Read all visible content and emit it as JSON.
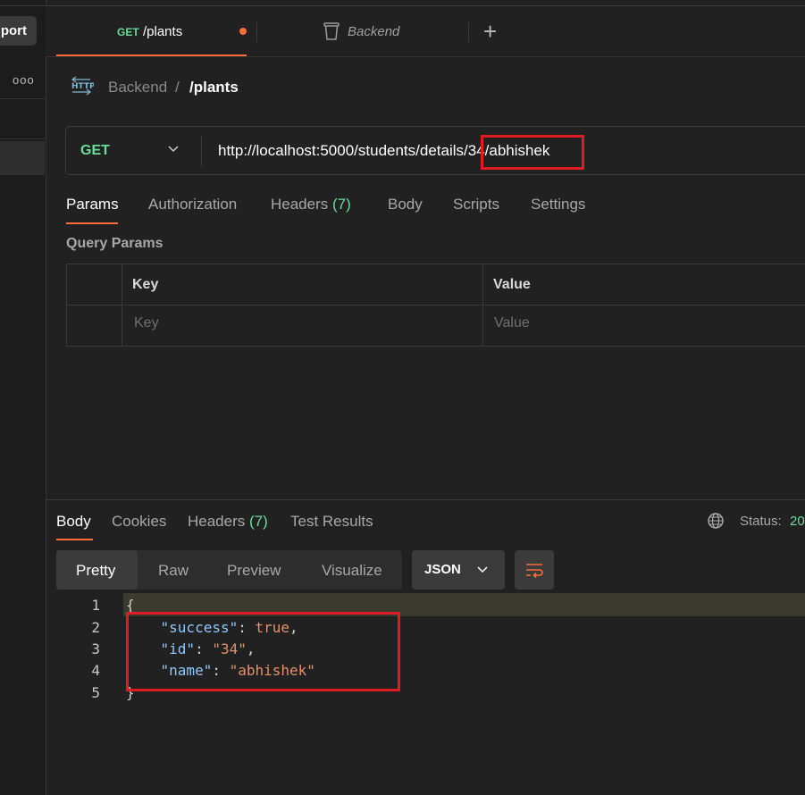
{
  "sidebar": {
    "import_label": "port",
    "more_label": "ooo"
  },
  "tabs": {
    "active": {
      "method": "GET",
      "title": "/plants",
      "unsaved": true
    },
    "second": {
      "title": "Backend",
      "icon": "trash-icon"
    },
    "add_label": "+"
  },
  "breadcrumb": {
    "icon": "http-icon",
    "parent": "Backend",
    "separator": "/",
    "current": "/plants"
  },
  "request": {
    "method": "GET",
    "url": "http://localhost:5000/students/details/34/abhishek"
  },
  "request_tabs": [
    {
      "label": "Params",
      "active": true
    },
    {
      "label": "Authorization"
    },
    {
      "label": "Headers",
      "count": "(7)"
    },
    {
      "label": "Body"
    },
    {
      "label": "Scripts"
    },
    {
      "label": "Settings"
    }
  ],
  "query_params": {
    "title": "Query Params",
    "headers": [
      "Key",
      "Value"
    ],
    "placeholder_row": [
      "Key",
      "Value"
    ]
  },
  "response": {
    "tabs": [
      {
        "label": "Body",
        "active": true
      },
      {
        "label": "Cookies"
      },
      {
        "label": "Headers",
        "count": "(7)"
      },
      {
        "label": "Test Results"
      }
    ],
    "status_label": "Status:",
    "status_value": "20",
    "view_modes": [
      "Pretty",
      "Raw",
      "Preview",
      "Visualize"
    ],
    "format": "JSON",
    "code_lines": {
      "numbers": [
        "1",
        "2",
        "3",
        "4",
        "5"
      ],
      "open_brace": "{",
      "close_brace": "}",
      "success_key": "\"success\"",
      "success_value": "true",
      "id_key": "\"id\"",
      "id_value": "\"34\"",
      "name_key": "\"name\"",
      "name_value": "\"abhishek\""
    }
  },
  "colors": {
    "accent": "#ff6c37",
    "method_get": "#6bdd9a",
    "highlight_box": "#e01b24",
    "json_key": "#8fc8ff",
    "json_value": "#e4916b"
  }
}
